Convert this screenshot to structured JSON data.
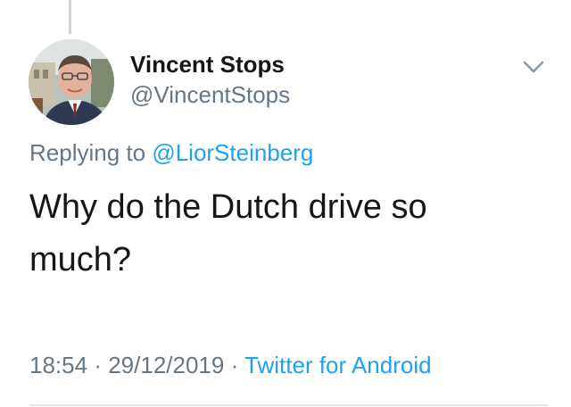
{
  "tweet": {
    "display_name": "Vincent Stops",
    "handle": "@VincentStops",
    "replying_prefix": "Replying to",
    "replying_to": "@LiorSteinberg",
    "text": "Why do the Dutch drive so much?",
    "time": "18:54",
    "separator": "·",
    "date": "29/12/2019",
    "source": "Twitter for Android"
  },
  "icons": {
    "menu": "chevron-down-icon",
    "avatar": "avatar"
  },
  "colors": {
    "link": "#1da1f2",
    "secondary_text": "#657786",
    "primary_text": "#14171a",
    "thread_line": "#ccd6dd",
    "divider": "#e1e8ed"
  }
}
